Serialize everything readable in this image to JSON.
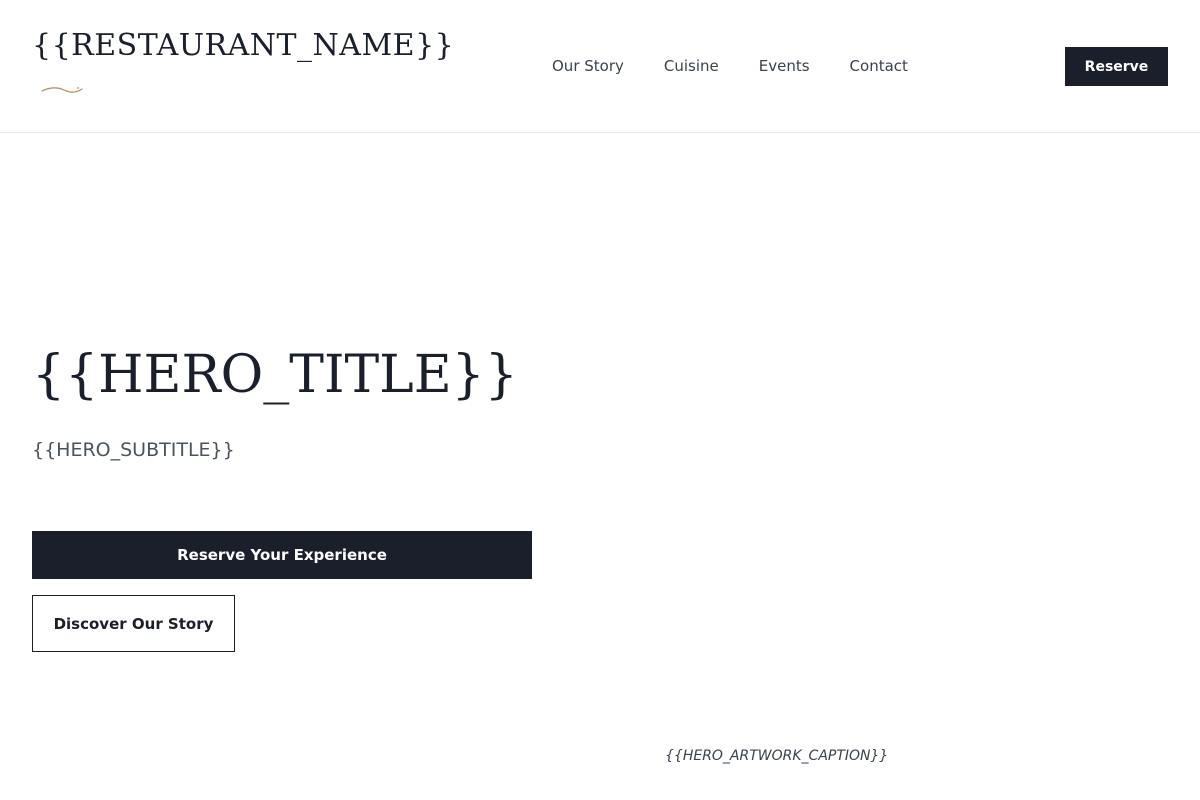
{
  "header": {
    "brand": "{{RESTAURANT_NAME}}",
    "nav": [
      {
        "label": "Our Story"
      },
      {
        "label": "Cuisine"
      },
      {
        "label": "Events"
      },
      {
        "label": "Contact"
      }
    ],
    "reserve_label": "Reserve"
  },
  "hero": {
    "title": "{{HERO_TITLE}}",
    "subtitle": "{{HERO_SUBTITLE}}",
    "primary_cta": "Reserve Your Experience",
    "secondary_cta": "Discover Our Story",
    "artwork_caption": "{{HERO_ARTWORK_CAPTION}}"
  },
  "icons": {
    "flourish": "flourish-ornament-icon"
  },
  "colors": {
    "primary": "#1a1f2b",
    "accent": "#b08d57"
  }
}
